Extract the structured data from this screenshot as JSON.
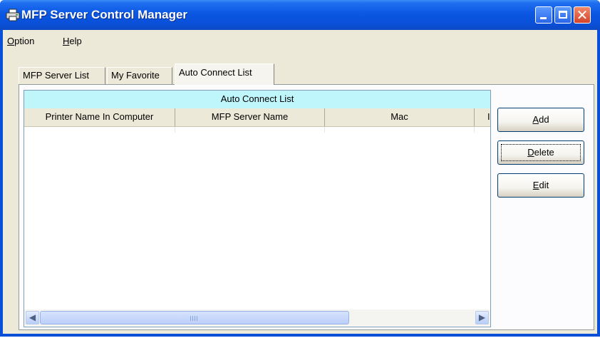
{
  "window": {
    "title": "MFP Server Control Manager",
    "title_icon": "printer-icon",
    "controls": [
      "minimize-icon",
      "maximize-icon",
      "close-icon"
    ]
  },
  "menu": [
    {
      "label_first": "O",
      "label_rest": "ption"
    },
    {
      "label_first": "H",
      "label_rest": "elp"
    }
  ],
  "tabs": [
    {
      "label": "MFP Server List",
      "active": false
    },
    {
      "label": "My Favorite",
      "active": false
    },
    {
      "label": "Auto Connect List",
      "active": true
    }
  ],
  "list": {
    "caption": "Auto Connect List",
    "columns": [
      "Printer Name In Computer",
      "MFP Server Name",
      "Mac",
      "I"
    ],
    "rows": []
  },
  "buttons": {
    "add": {
      "first": "A",
      "rest": "dd"
    },
    "delete": {
      "first": "D",
      "rest": "elete"
    },
    "edit": {
      "first": "E",
      "rest": "dit"
    }
  },
  "colors": {
    "titlebar": "#0a4fd8",
    "caption_bar": "#bff6fb",
    "window_bg": "#ece9d8"
  }
}
